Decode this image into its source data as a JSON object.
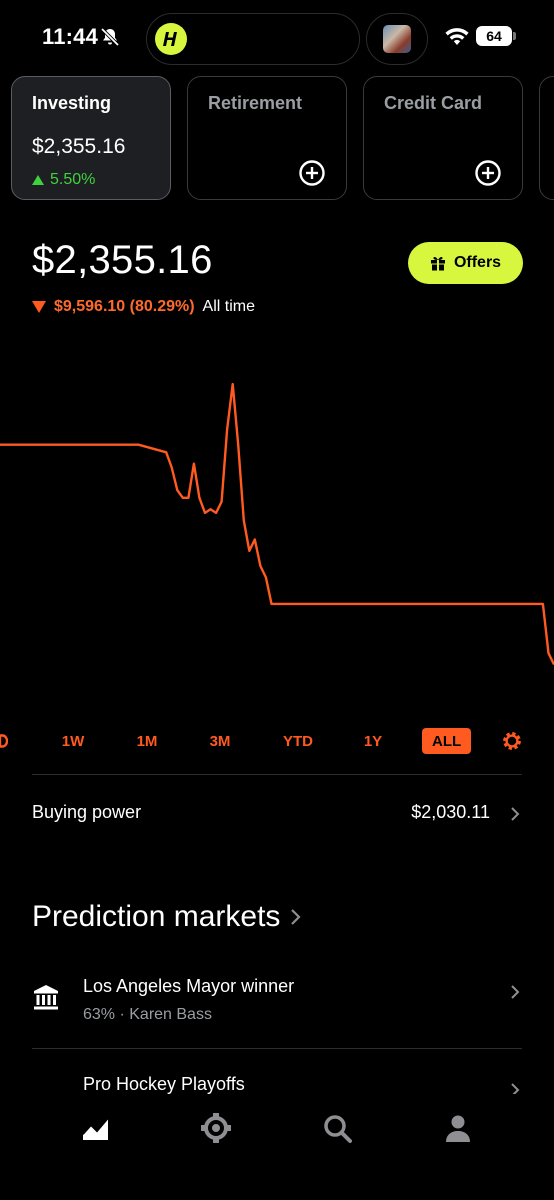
{
  "status_bar": {
    "time": "11:44",
    "battery": "64"
  },
  "accounts": [
    {
      "title": "Investing",
      "value": "$2,355.16",
      "change": "5.50%",
      "active": true
    },
    {
      "title": "Retirement"
    },
    {
      "title": "Credit Card"
    }
  ],
  "portfolio": {
    "value": "$2,355.16",
    "change_amount": "$9,596.10 (80.29%)",
    "change_period": "All time",
    "offers_label": "Offers"
  },
  "chart_data": {
    "type": "line",
    "color": "#ff5a1f",
    "x": [
      0,
      5,
      10,
      15,
      20,
      25,
      30,
      31,
      32,
      33,
      34,
      35,
      36,
      37,
      38,
      39,
      40,
      41,
      42,
      43,
      44,
      45,
      46,
      47,
      48,
      49,
      60,
      75,
      90,
      98,
      99,
      100
    ],
    "y": [
      100,
      100,
      100,
      100,
      100,
      100,
      98,
      94,
      88,
      86,
      86,
      95,
      86,
      82,
      83,
      82,
      85,
      104,
      116,
      100,
      80,
      72,
      75,
      68,
      65,
      58,
      58,
      58,
      58,
      58,
      45,
      42
    ],
    "ylim": [
      30,
      125
    ],
    "xlim": [
      0,
      100
    ],
    "grid": false
  },
  "ranges": {
    "items": [
      "1W",
      "1M",
      "3M",
      "YTD",
      "1Y",
      "ALL"
    ],
    "selected": "ALL"
  },
  "buying_power": {
    "label": "Buying power",
    "value": "$2,030.11"
  },
  "prediction_markets": {
    "heading": "Prediction markets",
    "items": [
      {
        "title": "Los Angeles Mayor winner",
        "subtitle": "63% · Karen Bass",
        "icon": "bank-icon"
      },
      {
        "title": "Pro Hockey Playoffs",
        "icon": "hockey-icon"
      }
    ]
  },
  "nav": [
    {
      "icon": "chart-icon",
      "active": true
    },
    {
      "icon": "crypto-icon",
      "active": false
    },
    {
      "icon": "search-icon",
      "active": false
    },
    {
      "icon": "person-icon",
      "active": false
    }
  ]
}
